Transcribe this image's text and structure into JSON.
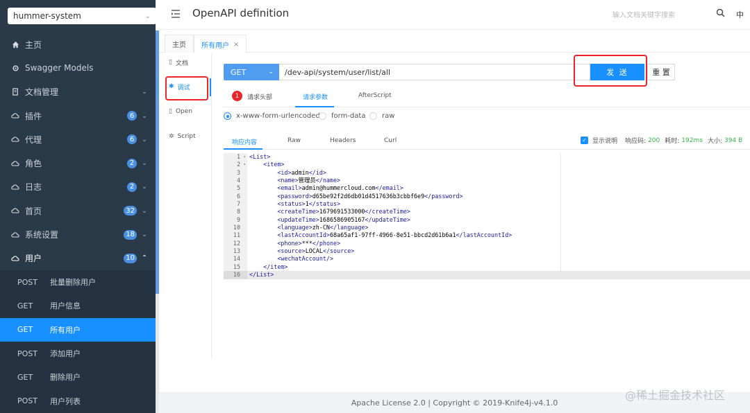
{
  "sidebar": {
    "project": "hummer-system",
    "items": [
      {
        "label": "主页",
        "icon": "home-icon"
      },
      {
        "label": "Swagger Models",
        "icon": "gear-icon"
      },
      {
        "label": "文档管理",
        "icon": "doc-icon"
      },
      {
        "label": "插件",
        "icon": "cloud-icon",
        "badge": "6"
      },
      {
        "label": "代理",
        "icon": "cloud-icon",
        "badge": "6"
      },
      {
        "label": "角色",
        "icon": "cloud-icon",
        "badge": "2"
      },
      {
        "label": "日志",
        "icon": "cloud-icon",
        "badge": "2"
      },
      {
        "label": "首页",
        "icon": "cloud-icon",
        "badge": "32"
      },
      {
        "label": "系统设置",
        "icon": "cloud-icon",
        "badge": "18"
      },
      {
        "label": "用户",
        "icon": "cloud-icon",
        "badge": "10"
      }
    ],
    "sub_items": [
      {
        "method": "POST",
        "label": "批量删除用户"
      },
      {
        "method": "GET",
        "label": "用户信息"
      },
      {
        "method": "GET",
        "label": "所有用户"
      },
      {
        "method": "POST",
        "label": "添加用户"
      },
      {
        "method": "GET",
        "label": "删除用户"
      },
      {
        "method": "POST",
        "label": "用户列表"
      }
    ]
  },
  "header": {
    "title": "OpenAPI definition",
    "search_placeholder": "输入文档关键字搜索",
    "lang": "中"
  },
  "tabs": {
    "home": "主页",
    "active": "所有用户",
    "close": "×"
  },
  "panel_nav": {
    "doc": "文档",
    "debug": "调试",
    "open": "Open",
    "script": "Script"
  },
  "request": {
    "method": "GET",
    "url": "/dev-api/system/user/list/all",
    "send": "发 送",
    "reset": "重 置",
    "header_count": "1",
    "tabs": [
      "请求头部",
      "请求参数",
      "AfterScript"
    ],
    "body_types": [
      "x-www-form-urlencoded",
      "form-data",
      "raw"
    ]
  },
  "response": {
    "tabs": [
      "响应内容",
      "Raw",
      "Headers",
      "Curl"
    ],
    "show_desc": "显示说明",
    "code_label": "响应码:",
    "code": "200",
    "time_label": "耗时:",
    "time": "192ms",
    "size_label": "大小:",
    "size": "394 B",
    "lines": [
      "<List>",
      "    <item>",
      "        <id>admin</id>",
      "        <name>管理员</name>",
      "        <email>admin@hummercloud.com</email>",
      "        <password>d65be92f2d6db01d4517636b3cbbf6e9</password>",
      "        <status>1</status>",
      "        <createTime>1679691533000</createTime>",
      "        <updateTime>1686586905167</updateTime>",
      "        <language>zh-CN</language>",
      "        <lastAccountId>68a65af1-97ff-4966-8e51-bbcd2d61b6a1</lastAccountId>",
      "        <phone>***</phone>",
      "        <source>LOCAL</source>",
      "        <wechatAccount/>",
      "    </item>",
      "</List>"
    ]
  },
  "footer": "Apache License 2.0 | Copyright © 2019-Knife4j-v4.1.0",
  "watermark": "@稀土掘金技术社区"
}
